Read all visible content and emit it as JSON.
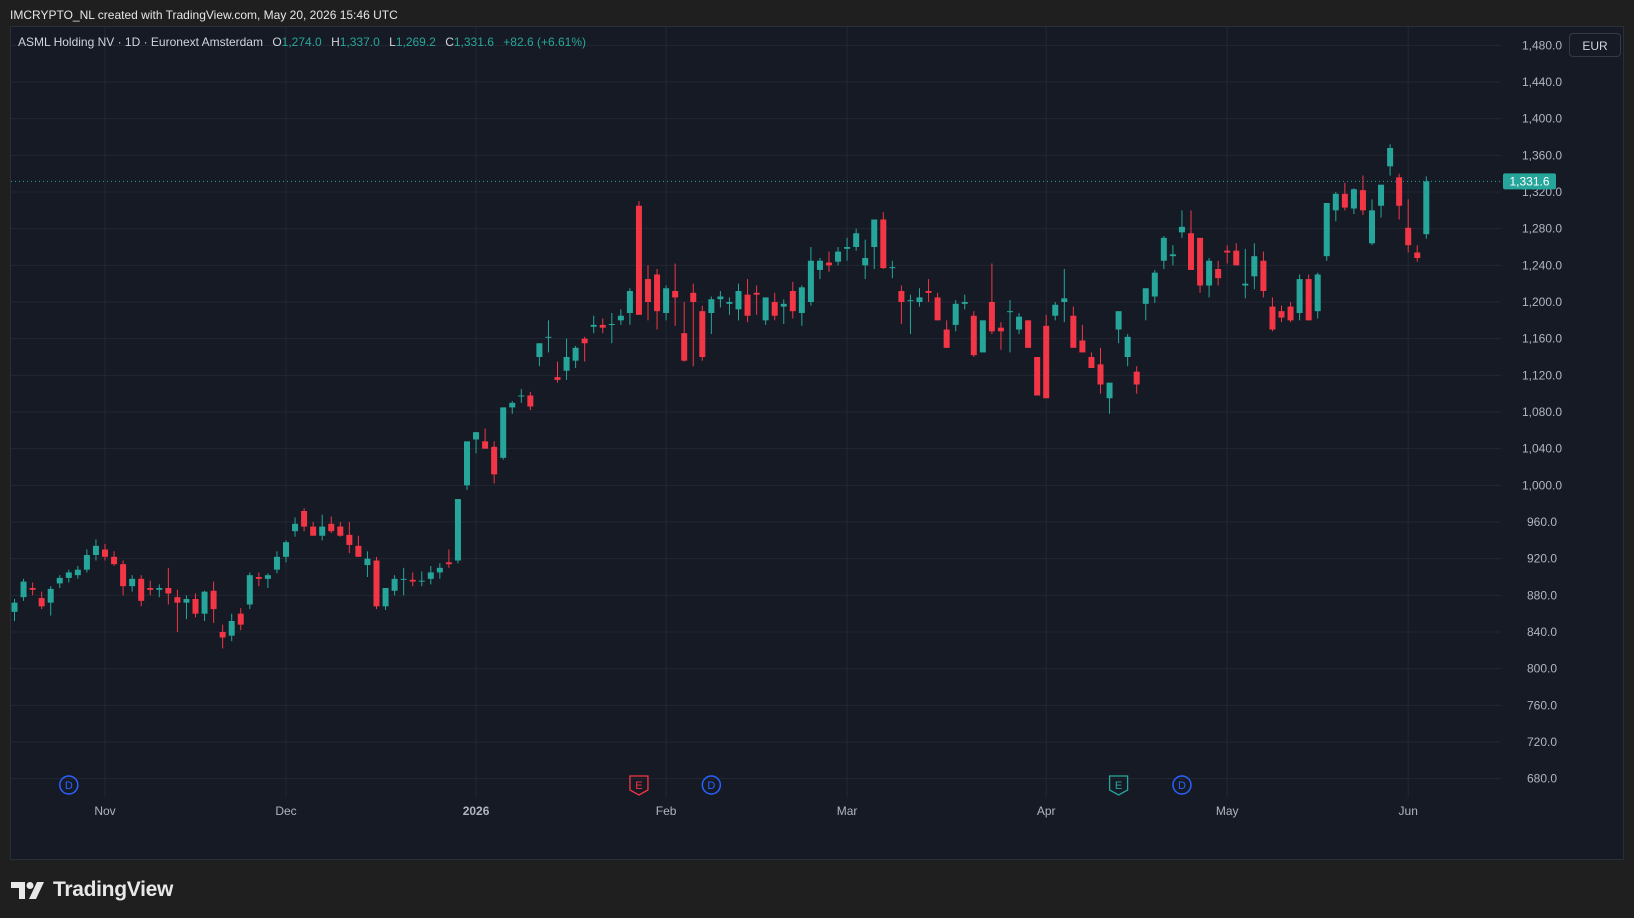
{
  "header": {
    "text": "IMCRYPTO_NL created with TradingView.com, May 20, 2026 15:46 UTC"
  },
  "legend": {
    "symbol": "ASML Holding NV · 1D · Euronext Amsterdam",
    "o_label": "O",
    "o_value": "1,274.0",
    "h_label": "H",
    "h_value": "1,337.0",
    "l_label": "L",
    "l_value": "1,269.2",
    "c_label": "C",
    "c_value": "1,331.6",
    "change": "+82.6 (+6.61%)"
  },
  "currency": "EUR",
  "last_price_label": "1,331.6",
  "footer": {
    "brand": "TradingView"
  },
  "colors": {
    "up": "#26a69a",
    "down": "#f23645",
    "grid": "#232734",
    "axis_text": "#b2b5be",
    "background": "#161a25",
    "event_blue": "#2962ff",
    "event_red": "#f23645",
    "event_green": "#26a69a"
  },
  "chart_data": {
    "type": "candlestick",
    "y_ticks": [
      "680.0",
      "720.0",
      "760.0",
      "800.0",
      "840.0",
      "880.0",
      "920.0",
      "960.0",
      "1,000.0",
      "1,040.0",
      "1,080.0",
      "1,120.0",
      "1,160.0",
      "1,200.0",
      "1,240.0",
      "1,280.0",
      "1,320.0",
      "1,360.0",
      "1,400.0",
      "1,440.0",
      "1,480.0"
    ],
    "y_range": [
      660,
      1500
    ],
    "x_labels": [
      {
        "label": "Nov",
        "bar": 10,
        "bold": false
      },
      {
        "label": "Dec",
        "bar": 30,
        "bold": false
      },
      {
        "label": "2026",
        "bar": 51,
        "bold": true
      },
      {
        "label": "Feb",
        "bar": 72,
        "bold": false
      },
      {
        "label": "Mar",
        "bar": 92,
        "bold": false
      },
      {
        "label": "Apr",
        "bar": 114,
        "bold": false
      },
      {
        "label": "May",
        "bar": 134,
        "bold": false
      },
      {
        "label": "Jun",
        "bar": 154,
        "bold": false
      }
    ],
    "events": [
      {
        "type": "D",
        "bar": 6
      },
      {
        "type": "E",
        "bar": 69
      },
      {
        "type": "D",
        "bar": 77
      },
      {
        "type": "E",
        "bar": 122
      },
      {
        "type": "D",
        "bar": 129
      }
    ],
    "ohlc": [
      [
        862,
        876,
        852,
        872
      ],
      [
        878,
        898,
        874,
        895
      ],
      [
        888,
        894,
        880,
        886
      ],
      [
        877,
        884,
        865,
        868
      ],
      [
        872,
        890,
        858,
        887
      ],
      [
        893,
        902,
        888,
        899
      ],
      [
        899,
        908,
        894,
        905
      ],
      [
        902,
        912,
        898,
        908
      ],
      [
        908,
        930,
        905,
        924
      ],
      [
        924,
        941,
        918,
        934
      ],
      [
        930,
        936,
        918,
        922
      ],
      [
        922,
        928,
        912,
        914
      ],
      [
        914,
        918,
        880,
        890
      ],
      [
        890,
        902,
        884,
        898
      ],
      [
        898,
        902,
        868,
        874
      ],
      [
        888,
        896,
        880,
        886
      ],
      [
        886,
        892,
        878,
        888
      ],
      [
        888,
        910,
        870,
        882
      ],
      [
        878,
        886,
        840,
        872
      ],
      [
        872,
        880,
        854,
        876
      ],
      [
        876,
        882,
        856,
        860
      ],
      [
        860,
        885,
        852,
        884
      ],
      [
        885,
        895,
        850,
        865
      ],
      [
        840,
        848,
        822,
        834
      ],
      [
        836,
        860,
        830,
        852
      ],
      [
        860,
        866,
        842,
        848
      ],
      [
        870,
        905,
        865,
        902
      ],
      [
        900,
        905,
        890,
        898
      ],
      [
        898,
        904,
        888,
        902
      ],
      [
        908,
        928,
        904,
        922
      ],
      [
        922,
        940,
        916,
        938
      ],
      [
        950,
        965,
        944,
        958
      ],
      [
        972,
        975,
        950,
        955
      ],
      [
        955,
        960,
        948,
        945
      ],
      [
        945,
        968,
        940,
        955
      ],
      [
        958,
        966,
        948,
        950
      ],
      [
        955,
        960,
        944,
        945
      ],
      [
        946,
        960,
        926,
        935
      ],
      [
        934,
        945,
        924,
        922
      ],
      [
        913,
        928,
        900,
        920
      ],
      [
        918,
        922,
        865,
        868
      ],
      [
        868,
        885,
        864,
        888
      ],
      [
        885,
        902,
        880,
        898
      ],
      [
        898,
        910,
        880,
        898
      ],
      [
        897,
        905,
        890,
        895
      ],
      [
        895,
        906,
        890,
        896
      ],
      [
        898,
        912,
        892,
        905
      ],
      [
        905,
        915,
        898,
        910
      ],
      [
        916,
        930,
        910,
        914
      ],
      [
        918,
        985,
        915,
        985
      ],
      [
        1000,
        1045,
        995,
        1048
      ],
      [
        1050,
        1058,
        1035,
        1058
      ],
      [
        1048,
        1062,
        1040,
        1040
      ],
      [
        1042,
        1048,
        1002,
        1012
      ],
      [
        1030,
        1085,
        1028,
        1085
      ],
      [
        1085,
        1092,
        1078,
        1090
      ],
      [
        1098,
        1105,
        1090,
        1098
      ],
      [
        1098,
        1102,
        1082,
        1086
      ],
      [
        1140,
        1155,
        1130,
        1155
      ],
      [
        1162,
        1180,
        1145,
        1162
      ],
      [
        1118,
        1135,
        1112,
        1115
      ],
      [
        1125,
        1160,
        1115,
        1140
      ],
      [
        1136,
        1152,
        1128,
        1150
      ],
      [
        1160,
        1162,
        1135,
        1155
      ],
      [
        1173,
        1185,
        1166,
        1175
      ],
      [
        1175,
        1182,
        1166,
        1172
      ],
      [
        1175,
        1188,
        1155,
        1176
      ],
      [
        1180,
        1192,
        1175,
        1185
      ],
      [
        1188,
        1215,
        1175,
        1212
      ],
      [
        1305,
        1310,
        1190,
        1186
      ],
      [
        1225,
        1240,
        1180,
        1200
      ],
      [
        1230,
        1236,
        1170,
        1190
      ],
      [
        1188,
        1218,
        1180,
        1215
      ],
      [
        1212,
        1242,
        1174,
        1205
      ],
      [
        1166,
        1200,
        1135,
        1136
      ],
      [
        1210,
        1220,
        1130,
        1200
      ],
      [
        1190,
        1196,
        1136,
        1140
      ],
      [
        1188,
        1206,
        1165,
        1203
      ],
      [
        1203,
        1212,
        1194,
        1206
      ],
      [
        1198,
        1205,
        1186,
        1200
      ],
      [
        1192,
        1220,
        1180,
        1212
      ],
      [
        1208,
        1225,
        1178,
        1185
      ],
      [
        1210,
        1218,
        1186,
        1208
      ],
      [
        1180,
        1202,
        1175,
        1205
      ],
      [
        1200,
        1210,
        1180,
        1185
      ],
      [
        1195,
        1203,
        1176,
        1198
      ],
      [
        1212,
        1222,
        1182,
        1190
      ],
      [
        1188,
        1218,
        1174,
        1216
      ],
      [
        1200,
        1260,
        1196,
        1245
      ],
      [
        1235,
        1248,
        1225,
        1245
      ],
      [
        1243,
        1255,
        1233,
        1240
      ],
      [
        1244,
        1260,
        1240,
        1255
      ],
      [
        1258,
        1270,
        1245,
        1260
      ],
      [
        1260,
        1280,
        1256,
        1275
      ],
      [
        1240,
        1268,
        1225,
        1248
      ],
      [
        1260,
        1288,
        1236,
        1290
      ],
      [
        1290,
        1298,
        1236,
        1237
      ],
      [
        1238,
        1245,
        1226,
        1238
      ],
      [
        1212,
        1218,
        1176,
        1200
      ],
      [
        1202,
        1208,
        1165,
        1202
      ],
      [
        1200,
        1215,
        1195,
        1205
      ],
      [
        1212,
        1225,
        1200,
        1210
      ],
      [
        1205,
        1210,
        1180,
        1180
      ],
      [
        1170,
        1180,
        1150,
        1150
      ],
      [
        1175,
        1202,
        1168,
        1198
      ],
      [
        1198,
        1208,
        1192,
        1200
      ],
      [
        1185,
        1190,
        1140,
        1142
      ],
      [
        1145,
        1180,
        1145,
        1180
      ],
      [
        1200,
        1242,
        1165,
        1168
      ],
      [
        1172,
        1178,
        1148,
        1168
      ],
      [
        1190,
        1202,
        1145,
        1190
      ],
      [
        1170,
        1188,
        1165,
        1184
      ],
      [
        1180,
        1180,
        1150,
        1150
      ],
      [
        1140,
        1135,
        1100,
        1098
      ],
      [
        1174,
        1186,
        1098,
        1095
      ],
      [
        1185,
        1200,
        1180,
        1197
      ],
      [
        1200,
        1236,
        1178,
        1204
      ],
      [
        1185,
        1195,
        1160,
        1150
      ],
      [
        1158,
        1175,
        1155,
        1145
      ],
      [
        1140,
        1145,
        1128,
        1128
      ],
      [
        1132,
        1150,
        1100,
        1110
      ],
      [
        1095,
        1112,
        1078,
        1112
      ],
      [
        1170,
        1185,
        1155,
        1190
      ],
      [
        1140,
        1165,
        1130,
        1162
      ],
      [
        1124,
        1130,
        1100,
        1110
      ],
      [
        1198,
        1215,
        1180,
        1215
      ],
      [
        1206,
        1235,
        1199,
        1232
      ],
      [
        1245,
        1272,
        1236,
        1270
      ],
      [
        1250,
        1262,
        1240,
        1252
      ],
      [
        1276,
        1300,
        1270,
        1282
      ],
      [
        1275,
        1300,
        1235,
        1235
      ],
      [
        1270,
        1268,
        1210,
        1218
      ],
      [
        1218,
        1248,
        1205,
        1245
      ],
      [
        1236,
        1245,
        1218,
        1226
      ],
      [
        1256,
        1262,
        1242,
        1254
      ],
      [
        1256,
        1264,
        1240,
        1240
      ],
      [
        1218,
        1258,
        1204,
        1220
      ],
      [
        1228,
        1264,
        1214,
        1250
      ],
      [
        1245,
        1255,
        1205,
        1212
      ],
      [
        1195,
        1205,
        1168,
        1170
      ],
      [
        1190,
        1196,
        1178,
        1183
      ],
      [
        1195,
        1200,
        1178,
        1180
      ],
      [
        1188,
        1230,
        1180,
        1225
      ],
      [
        1225,
        1230,
        1180,
        1180
      ],
      [
        1190,
        1232,
        1182,
        1230
      ],
      [
        1250,
        1308,
        1245,
        1308
      ],
      [
        1300,
        1320,
        1288,
        1318
      ],
      [
        1318,
        1330,
        1300,
        1303
      ],
      [
        1302,
        1324,
        1296,
        1323
      ],
      [
        1322,
        1338,
        1295,
        1300
      ],
      [
        1264,
        1312,
        1262,
        1300
      ],
      [
        1305,
        1320,
        1292,
        1328
      ],
      [
        1348,
        1372,
        1338,
        1368
      ],
      [
        1336,
        1340,
        1290,
        1305
      ],
      [
        1281,
        1312,
        1254,
        1262
      ],
      [
        1254,
        1262,
        1244,
        1248
      ],
      [
        1274,
        1337,
        1269,
        1331.6
      ]
    ]
  }
}
